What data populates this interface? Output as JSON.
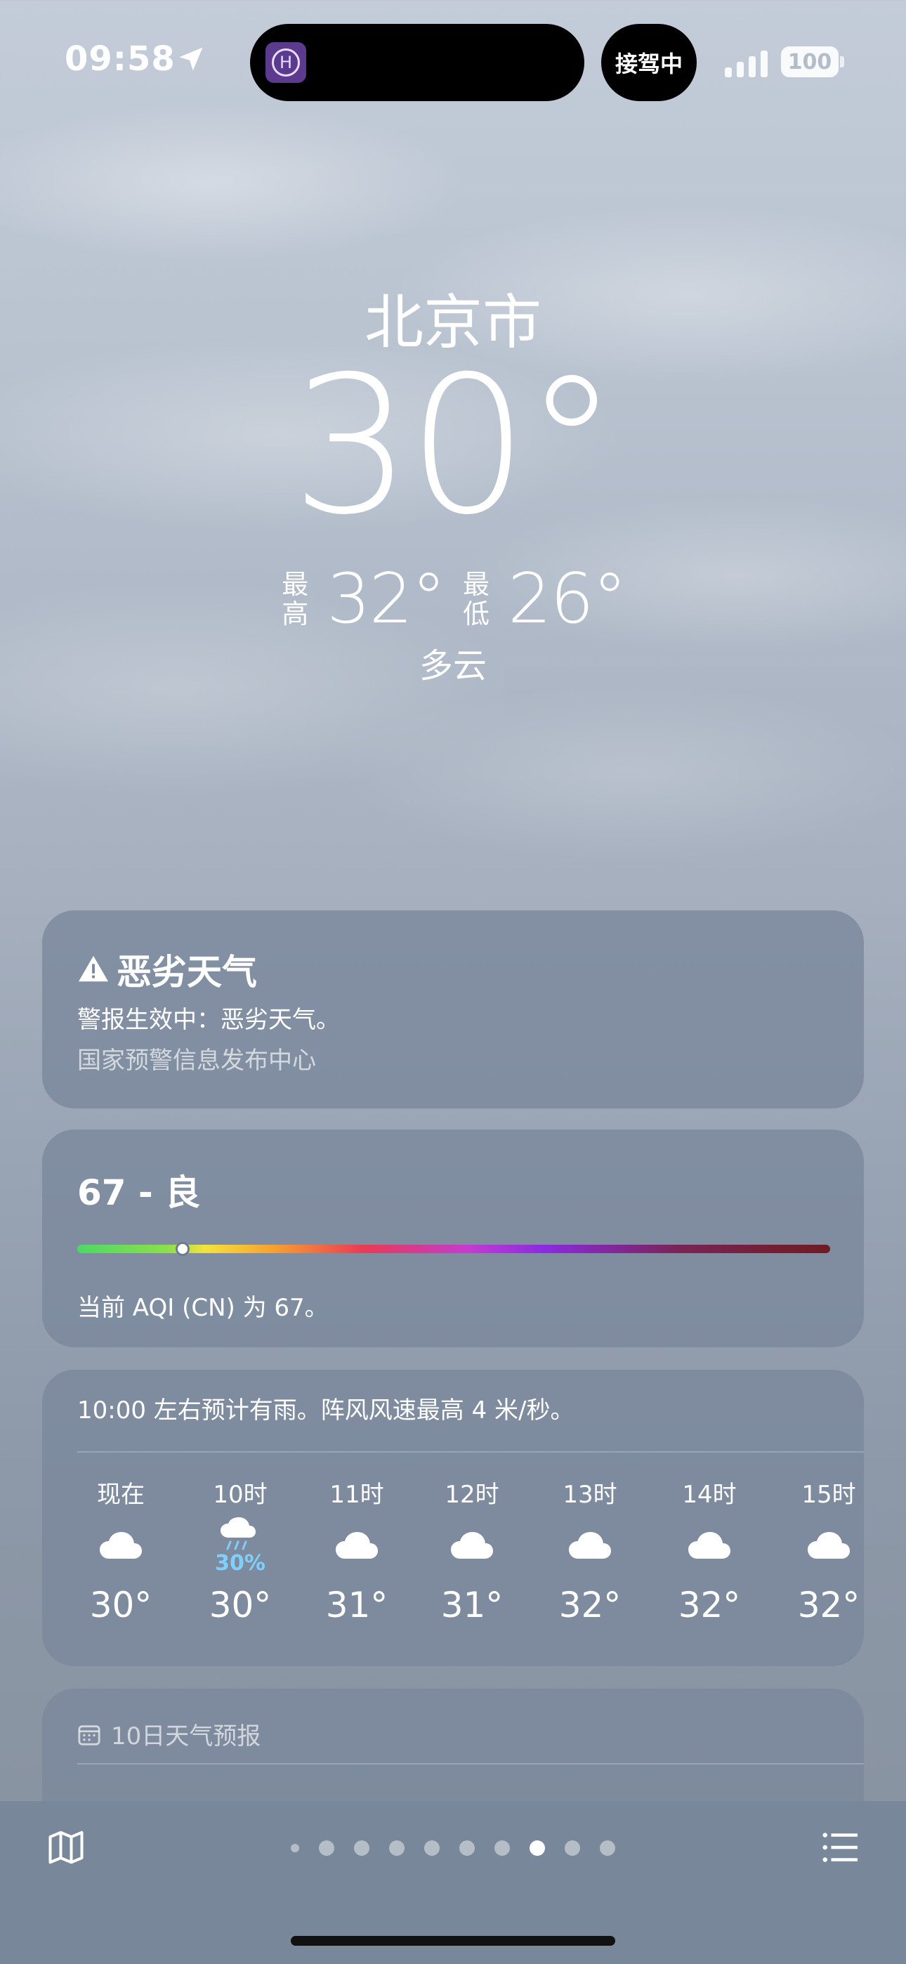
{
  "status_bar": {
    "time": "09:58",
    "ride_status": "接驾中",
    "battery": "100"
  },
  "weather": {
    "city": "北京市",
    "temperature": "30°",
    "high_label": "最高",
    "high": "32°",
    "low_label": "最低",
    "low": "26°",
    "condition": "多云"
  },
  "alert": {
    "title": "恶劣天气",
    "body": "警报生效中：恶劣天气。",
    "source": "国家预警信息发布中心"
  },
  "aqi": {
    "value_label": "67 - 良",
    "value": 67,
    "scale_fraction": 0.14,
    "description": "当前 AQI (CN) 为 67。"
  },
  "hourly": {
    "summary": "10:00 左右预计有雨。阵风风速最高 4 米/秒。",
    "items": [
      {
        "time": "现在",
        "icon": "cloud-icon",
        "precip": "",
        "temp": "30°"
      },
      {
        "time": "10时",
        "icon": "cloud-rain-icon",
        "precip": "30%",
        "temp": "30°"
      },
      {
        "time": "11时",
        "icon": "cloud-icon",
        "precip": "",
        "temp": "31°"
      },
      {
        "time": "12时",
        "icon": "cloud-icon",
        "precip": "",
        "temp": "31°"
      },
      {
        "time": "13时",
        "icon": "cloud-icon",
        "precip": "",
        "temp": "32°"
      },
      {
        "time": "14时",
        "icon": "cloud-icon",
        "precip": "",
        "temp": "32°"
      },
      {
        "time": "15时",
        "icon": "cloud-icon",
        "precip": "",
        "temp": "32°"
      }
    ]
  },
  "ten_day": {
    "title": "10日天气预报"
  },
  "pager": {
    "page_count": 10,
    "active_index": 7
  },
  "colors": {
    "card": "#7a889c",
    "precip": "#7fd0ff",
    "bottom_bar": "#78879a"
  }
}
